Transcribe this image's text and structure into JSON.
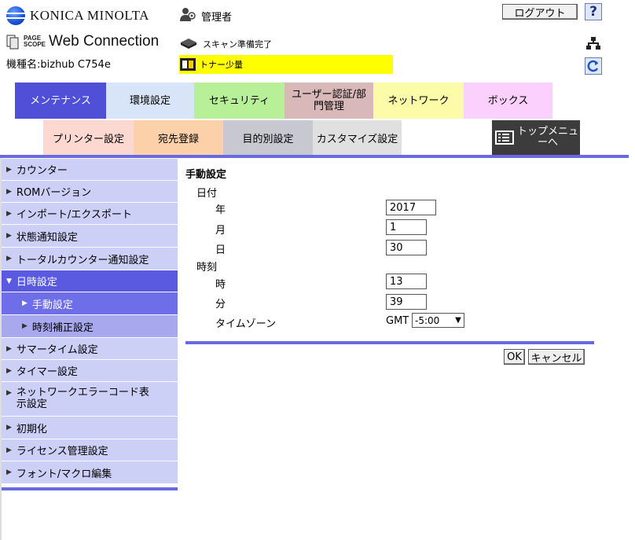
{
  "header": {
    "brand": "KONICA MINOLTA",
    "product_small_1": "PAGE",
    "product_small_2": "SCOPE",
    "product": "Web Connection",
    "model": "機種名:bizhub C754e",
    "user": "管理者",
    "status_scan": "スキャン準備完了",
    "status_toner": "トナー少量",
    "logout": "ログアウト",
    "help": "?",
    "colors": {
      "toner_bg": "#ffff00"
    }
  },
  "tabs": [
    {
      "label": "メンテナンス",
      "color": "#4f4fd8"
    },
    {
      "label": "環境設定",
      "color": "#d8e4f8"
    },
    {
      "label": "セキュリティ",
      "color": "#b8f098"
    },
    {
      "label": "ユーザー認証/部門管理",
      "color": "#d8b8b8"
    },
    {
      "label": "ネットワーク",
      "color": "#fcfca8"
    },
    {
      "label": "ボックス",
      "color": "#fcd0fc"
    }
  ],
  "subtabs": [
    {
      "label": "プリンター設定",
      "color": "#fcd8d0"
    },
    {
      "label": "宛先登録",
      "color": "#fcd0a8"
    },
    {
      "label": "目的別設定",
      "color": "#c8c8d0"
    },
    {
      "label": "カスタマイズ設定",
      "color": "#e0e0e0"
    }
  ],
  "topmenu": "トップメニューへ",
  "sidebar": {
    "items": [
      {
        "label": "カウンター"
      },
      {
        "label": "ROMバージョン"
      },
      {
        "label": "インポート/エクスポート"
      },
      {
        "label": "状態通知設定"
      },
      {
        "label": "トータルカウンター通知設定"
      },
      {
        "label": "日時設定"
      },
      {
        "label": "手動設定"
      },
      {
        "label": "時刻補正設定"
      },
      {
        "label": "サマータイム設定"
      },
      {
        "label": "タイマー設定"
      },
      {
        "label": "ネットワークエラーコード表示設定"
      },
      {
        "label": "初期化"
      },
      {
        "label": "ライセンス管理設定"
      },
      {
        "label": "フォント/マクロ編集"
      }
    ]
  },
  "form": {
    "title": "手動設定",
    "date_section": "日付",
    "year_label": "年",
    "year": "2017",
    "month_label": "月",
    "month": "1",
    "day_label": "日",
    "day": "30",
    "time_section": "時刻",
    "hour_label": "時",
    "hour": "13",
    "minute_label": "分",
    "minute": "39",
    "tz_label": "タイムゾーン",
    "tz_prefix": "GMT",
    "tz_value": "-5:00",
    "ok": "OK",
    "cancel": "キャンセル"
  }
}
